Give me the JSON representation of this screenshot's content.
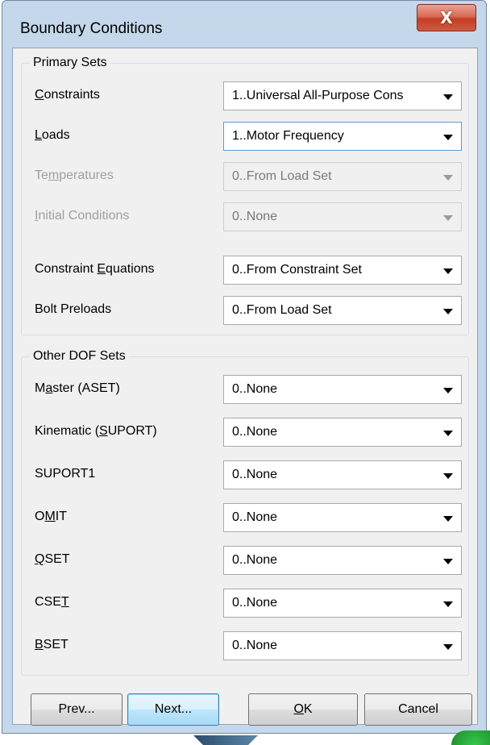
{
  "window": {
    "title": "Boundary Conditions",
    "close_glyph": "X"
  },
  "primary": {
    "label": "Primary Sets",
    "rows": [
      {
        "pre": "",
        "u": "C",
        "post": "onstraints",
        "value": "1..Universal All-Purpose Cons",
        "disabled": false
      },
      {
        "pre": "",
        "u": "L",
        "post": "oads",
        "value": "1..Motor Frequency",
        "disabled": false
      },
      {
        "pre": "Te",
        "u": "m",
        "post": "peratures",
        "value": "0..From Load Set",
        "disabled": true
      },
      {
        "pre": "",
        "u": "I",
        "post": "nitial Conditions",
        "value": "0..None",
        "disabled": true
      },
      {
        "pre": "Constraint ",
        "u": "E",
        "post": "quations",
        "value": "0..From Constraint Set",
        "disabled": false
      },
      {
        "pre": "Bolt Preloads",
        "u": "",
        "post": "",
        "value": "0..From Load Set",
        "disabled": false
      }
    ]
  },
  "other": {
    "label": "Other DOF Sets",
    "rows": [
      {
        "pre": "M",
        "u": "a",
        "post": "ster (ASET)",
        "value": "0..None"
      },
      {
        "pre": "Kinematic (",
        "u": "S",
        "post": "UPORT)",
        "value": "0..None"
      },
      {
        "pre": "SUPORT1",
        "u": "",
        "post": "",
        "value": "0..None"
      },
      {
        "pre": "O",
        "u": "M",
        "post": "IT",
        "value": "0..None"
      },
      {
        "pre": "",
        "u": "Q",
        "post": "SET",
        "value": "0..None"
      },
      {
        "pre": "CSE",
        "u": "T",
        "post": "",
        "value": "0..None"
      },
      {
        "pre": "",
        "u": "B",
        "post": "SET",
        "value": "0..None"
      }
    ]
  },
  "buttons": {
    "prev": "Prev...",
    "next": "Next...",
    "ok_u": "O",
    "ok_rest": "K",
    "cancel": "Cancel"
  }
}
